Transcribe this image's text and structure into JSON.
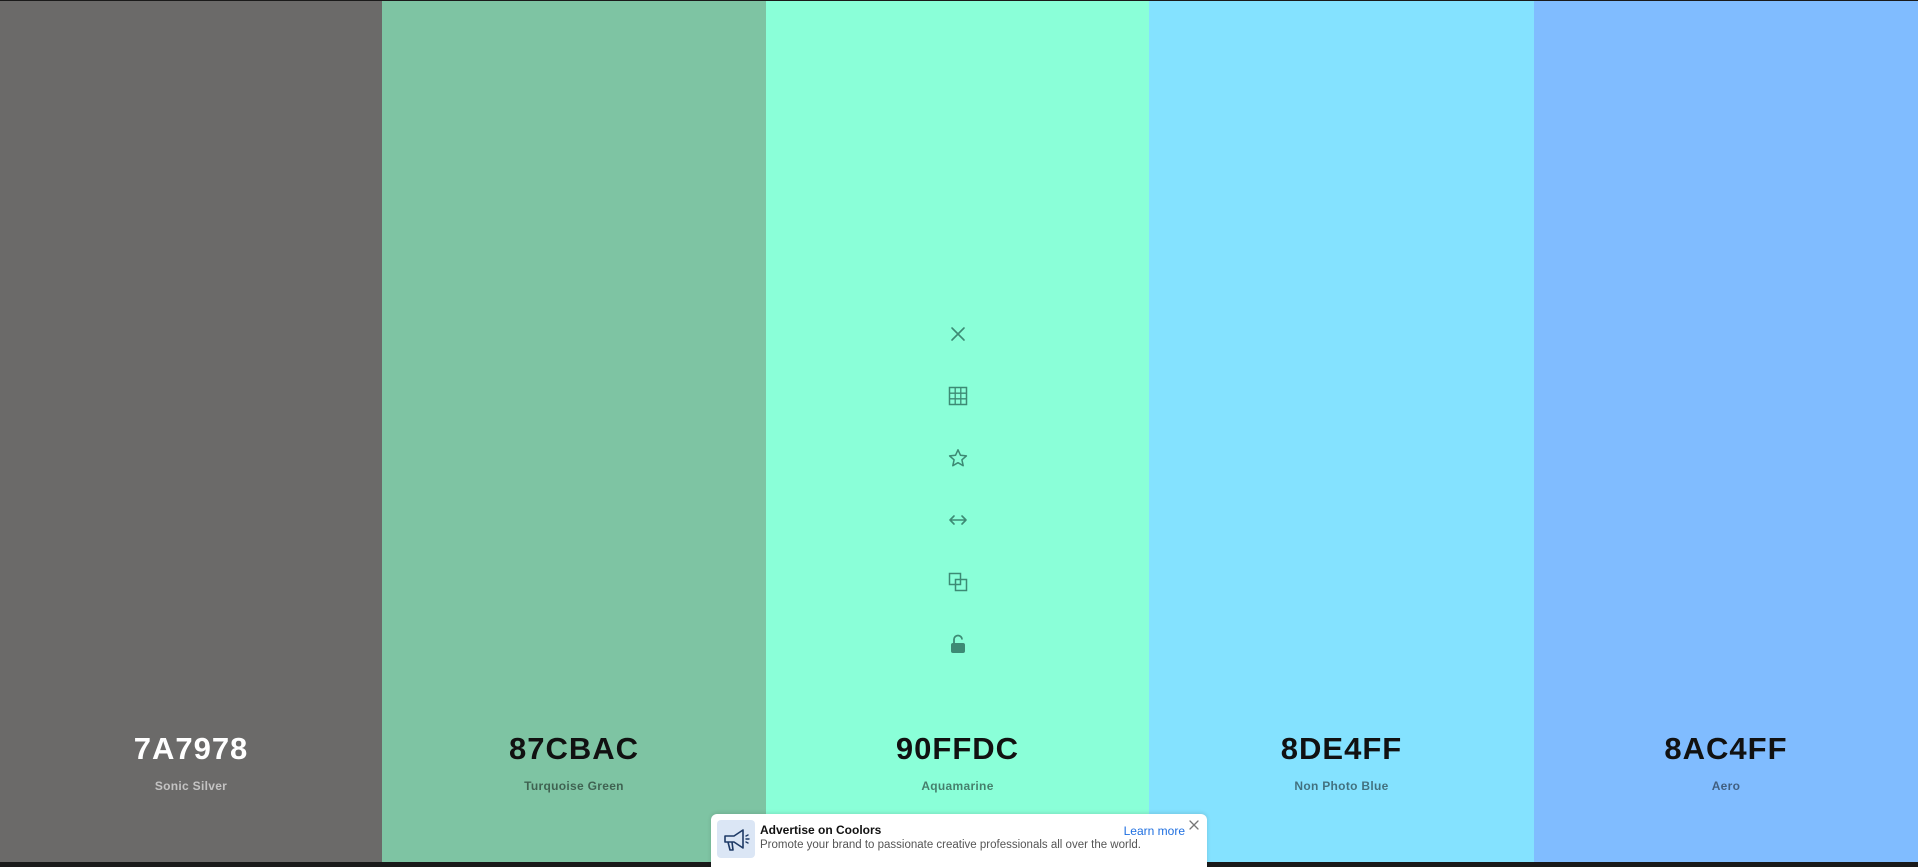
{
  "palette": {
    "colors": [
      {
        "hex": "7A7978",
        "name": "Sonic Silver",
        "bg": "#6b6a69"
      },
      {
        "hex": "87CBAC",
        "name": "Turquoise Green",
        "bg": "#7ec4a3"
      },
      {
        "hex": "90FFDC",
        "name": "Aquamarine",
        "bg": "#8affd8"
      },
      {
        "hex": "8DE4FF",
        "name": "Non Photo Blue",
        "bg": "#84e2ff"
      },
      {
        "hex": "8AC4FF",
        "name": "Aero",
        "bg": "#80bcff"
      }
    ],
    "active_index": 2,
    "tool_color": "#3d8a74",
    "tools": [
      "close-icon",
      "grid-icon",
      "star-icon",
      "drag-arrows-icon",
      "copy-icon",
      "unlock-icon"
    ]
  },
  "ad": {
    "title": "Advertise on Coolors",
    "text": "Promote your brand to passionate creative professionals all over the world.",
    "link": "Learn more",
    "icon": "megaphone-icon",
    "link_color": "#1f6fe0"
  }
}
